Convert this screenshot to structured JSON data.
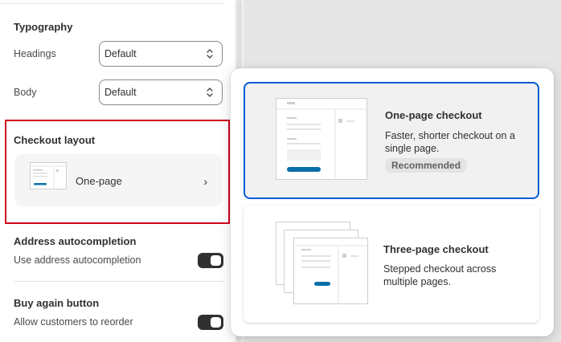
{
  "sidebar": {
    "typography": {
      "title": "Typography",
      "headings_label": "Headings",
      "headings_value": "Default",
      "body_label": "Body",
      "body_value": "Default"
    },
    "checkout_layout": {
      "title": "Checkout layout",
      "selected_label": "One-page"
    },
    "address_autocompletion": {
      "title": "Address autocompletion",
      "label": "Use address autocompletion",
      "enabled": true
    },
    "buy_again": {
      "title": "Buy again button",
      "label": "Allow customers to reorder",
      "enabled": true
    }
  },
  "popover": {
    "options": [
      {
        "title": "One-page checkout",
        "description": "Faster, shorter checkout on a single page.",
        "badge": "Recommended",
        "selected": true
      },
      {
        "title": "Three-page checkout",
        "description": "Stepped checkout across multiple pages.",
        "selected": false
      }
    ]
  },
  "colors": {
    "accent": "#005bd3",
    "highlight_border": "#d0021b",
    "button_blue": "#0a6fa8",
    "toggle_on": "#303030"
  },
  "icons": {
    "select_chevron": "chevron-up-down-icon",
    "row_chevron": "chevron-right-icon"
  }
}
